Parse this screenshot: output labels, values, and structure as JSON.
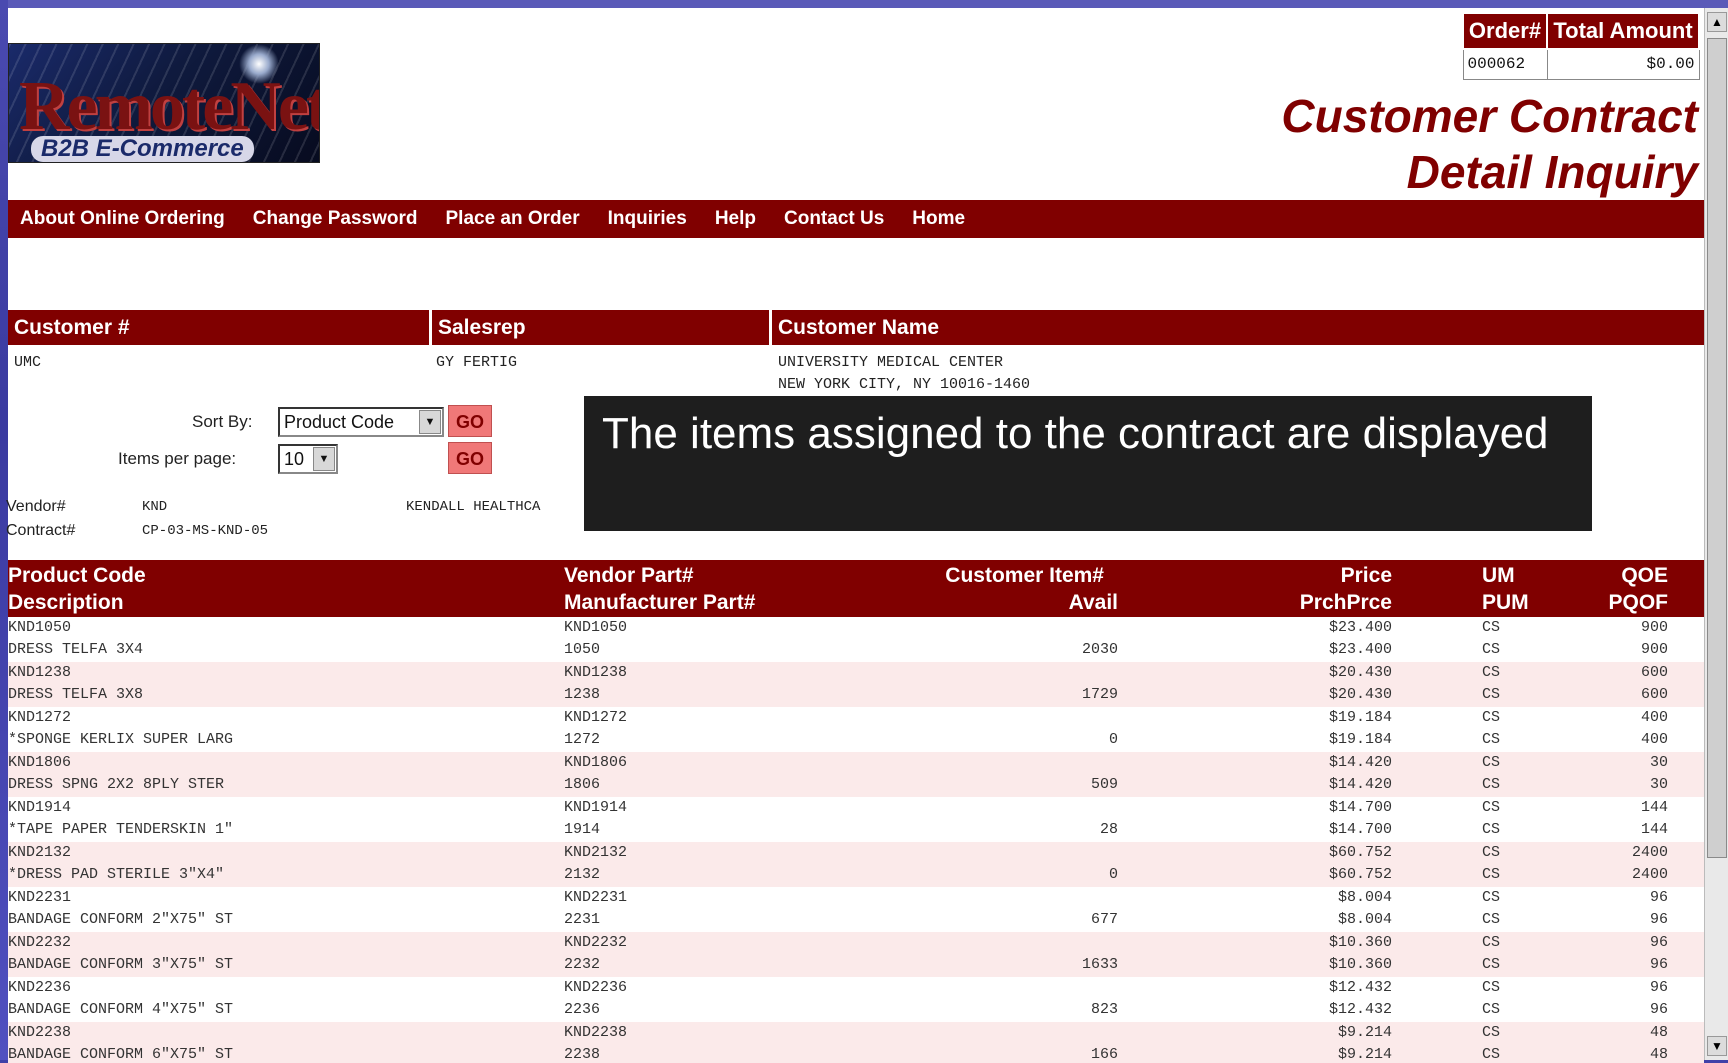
{
  "logo": {
    "main": "RemoteNet",
    "sub": "B2B E-Commerce"
  },
  "order_box": {
    "order_header": "Order#",
    "total_header": "Total Amount",
    "order_value": "000062",
    "total_value": "$0.00"
  },
  "page_title": {
    "line1": "Customer Contract",
    "line2": "Detail Inquiry"
  },
  "nav": [
    "About Online Ordering",
    "Change Password",
    "Place an Order",
    "Inquiries",
    "Help",
    "Contact Us",
    "Home"
  ],
  "customer": {
    "headers": {
      "customer": "Customer #",
      "salesrep": "Salesrep",
      "name": "Customer Name"
    },
    "customer_no": "UMC",
    "salesrep": "GY FERTIG",
    "name_line1": "UNIVERSITY MEDICAL CENTER",
    "name_line2": "NEW YORK CITY, NY 10016-1460"
  },
  "controls": {
    "sort_label": "Sort By:",
    "sort_value": "Product Code",
    "items_label": "Items per page:",
    "items_value": "10",
    "go_label": "GO"
  },
  "vendor": {
    "vendor_label": "Vendor#",
    "vendor_value": "KND",
    "vendor_name": "KENDALL HEALTHCA",
    "contract_label": "Contract#",
    "contract_value": "CP-03-MS-KND-05"
  },
  "caption": "The items assigned to the contract are displayed",
  "table": {
    "headers": {
      "product_code": "Product Code",
      "description": "Description",
      "vendor_part": "Vendor Part#",
      "mfr_part": "Manufacturer Part#",
      "cust_item": "Customer Item#",
      "avail": "Avail",
      "price": "Price",
      "prch_price": "PrchPrce",
      "um": "UM",
      "pum": "PUM",
      "qoe": "QOE",
      "pqof": "PQOF"
    },
    "rows": [
      {
        "code": "KND1050",
        "desc": "DRESS TELFA 3X4",
        "vpart": "KND1050",
        "mpart": "1050",
        "avail": "2030",
        "price": "$23.400",
        "prch": "$23.400",
        "um": "CS",
        "pum": "CS",
        "qoe": "900",
        "pqof": "900"
      },
      {
        "code": "KND1238",
        "desc": "DRESS TELFA 3X8",
        "vpart": "KND1238",
        "mpart": "1238",
        "avail": "1729",
        "price": "$20.430",
        "prch": "$20.430",
        "um": "CS",
        "pum": "CS",
        "qoe": "600",
        "pqof": "600"
      },
      {
        "code": "KND1272",
        "desc": "*SPONGE KERLIX SUPER LARG",
        "vpart": "KND1272",
        "mpart": "1272",
        "avail": "0",
        "price": "$19.184",
        "prch": "$19.184",
        "um": "CS",
        "pum": "CS",
        "qoe": "400",
        "pqof": "400"
      },
      {
        "code": "KND1806",
        "desc": "DRESS SPNG 2X2 8PLY STER",
        "vpart": "KND1806",
        "mpart": "1806",
        "avail": "509",
        "price": "$14.420",
        "prch": "$14.420",
        "um": "CS",
        "pum": "CS",
        "qoe": "30",
        "pqof": "30"
      },
      {
        "code": "KND1914",
        "desc": "*TAPE PAPER TENDERSKIN 1\"",
        "vpart": "KND1914",
        "mpart": "1914",
        "avail": "28",
        "price": "$14.700",
        "prch": "$14.700",
        "um": "CS",
        "pum": "CS",
        "qoe": "144",
        "pqof": "144"
      },
      {
        "code": "KND2132",
        "desc": "*DRESS PAD STERILE 3\"X4\"",
        "vpart": "KND2132",
        "mpart": "2132",
        "avail": "0",
        "price": "$60.752",
        "prch": "$60.752",
        "um": "CS",
        "pum": "CS",
        "qoe": "2400",
        "pqof": "2400"
      },
      {
        "code": "KND2231",
        "desc": "BANDAGE CONFORM 2\"X75\" ST",
        "vpart": "KND2231",
        "mpart": "2231",
        "avail": "677",
        "price": "$8.004",
        "prch": "$8.004",
        "um": "CS",
        "pum": "CS",
        "qoe": "96",
        "pqof": "96"
      },
      {
        "code": "KND2232",
        "desc": "BANDAGE CONFORM 3\"X75\" ST",
        "vpart": "KND2232",
        "mpart": "2232",
        "avail": "1633",
        "price": "$10.360",
        "prch": "$10.360",
        "um": "CS",
        "pum": "CS",
        "qoe": "96",
        "pqof": "96"
      },
      {
        "code": "KND2236",
        "desc": "BANDAGE CONFORM 4\"X75\" ST",
        "vpart": "KND2236",
        "mpart": "2236",
        "avail": "823",
        "price": "$12.432",
        "prch": "$12.432",
        "um": "CS",
        "pum": "CS",
        "qoe": "96",
        "pqof": "96"
      },
      {
        "code": "KND2238",
        "desc": "BANDAGE CONFORM 6\"X75\" ST",
        "vpart": "KND2238",
        "mpart": "2238",
        "avail": "166",
        "price": "$9.214",
        "prch": "$9.214",
        "um": "CS",
        "pum": "CS",
        "qoe": "48",
        "pqof": "48"
      }
    ]
  }
}
